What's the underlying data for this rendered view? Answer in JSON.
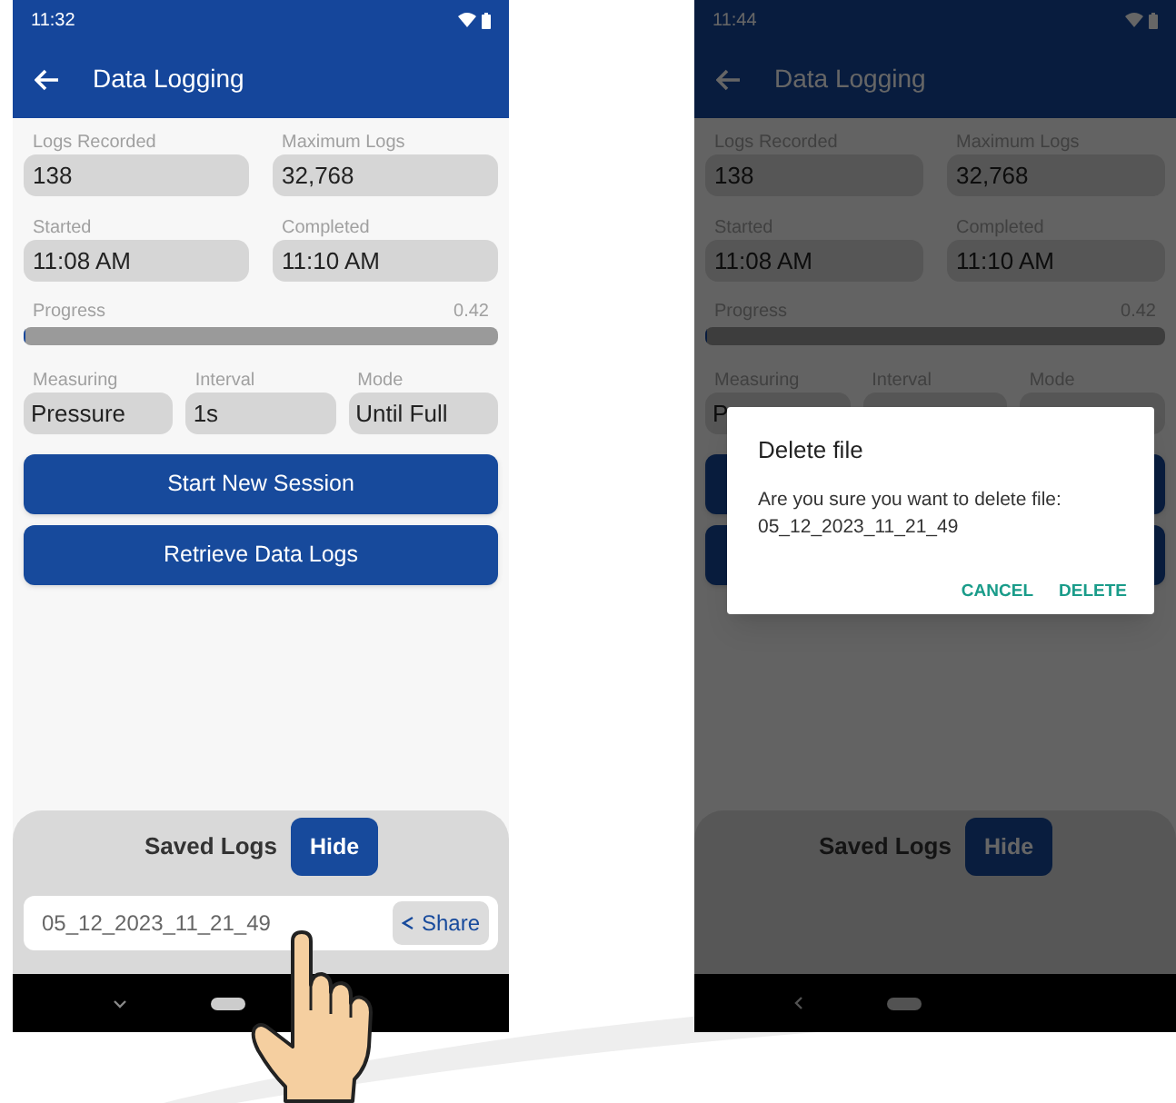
{
  "phones": [
    {
      "status_time": "11:32",
      "title": "Data Logging",
      "dimmed": false,
      "touch_hand": true,
      "keyboard_open": true,
      "fields": [
        {
          "label": "Logs Recorded",
          "value": "138"
        },
        {
          "label": "Maximum Logs",
          "value": "32,768"
        },
        {
          "label": "Started",
          "value": "11:08 AM"
        },
        {
          "label": "Completed",
          "value": "11:10 AM"
        }
      ],
      "progress": {
        "label": "Progress",
        "reading": "0.42",
        "level": 0.005
      },
      "settings": [
        {
          "label": "Measuring",
          "value": "Pressure"
        },
        {
          "label": "Interval",
          "value": "1s"
        },
        {
          "label": "Mode",
          "value": "Until Full"
        }
      ],
      "buttons": [
        {
          "label": "Start New Session"
        },
        {
          "label": "Retrieve Data Logs"
        }
      ],
      "saved_logs": {
        "title": "Saved Logs",
        "hide": "Hide",
        "files": [
          {
            "name": "05_12_2023_11_21_49",
            "action": "Share"
          }
        ]
      }
    },
    {
      "status_time": "11:44",
      "title": "Data Logging",
      "dimmed": true,
      "touch_hand": false,
      "keyboard_open": false,
      "fields": [
        {
          "label": "Logs Recorded",
          "value": "138"
        },
        {
          "label": "Maximum Logs",
          "value": "32,768"
        },
        {
          "label": "Started",
          "value": "11:08 AM"
        },
        {
          "label": "Completed",
          "value": "11:10 AM"
        }
      ],
      "progress": {
        "label": "Progress",
        "reading": "0.42",
        "level": 0.005
      },
      "settings": [
        {
          "label": "Measuring",
          "value": "P"
        },
        {
          "label": "Interval"
        },
        {
          "label": "Mode"
        }
      ],
      "saved_logs": {
        "title": "Saved Logs",
        "hide": "Hide"
      },
      "dialog": {
        "title": "Delete file",
        "message": "Are you sure you want to delete file:",
        "file_name": "05_12_2023_11_21_49",
        "actions": [
          "CANCEL",
          "DELETE"
        ]
      }
    }
  ]
}
